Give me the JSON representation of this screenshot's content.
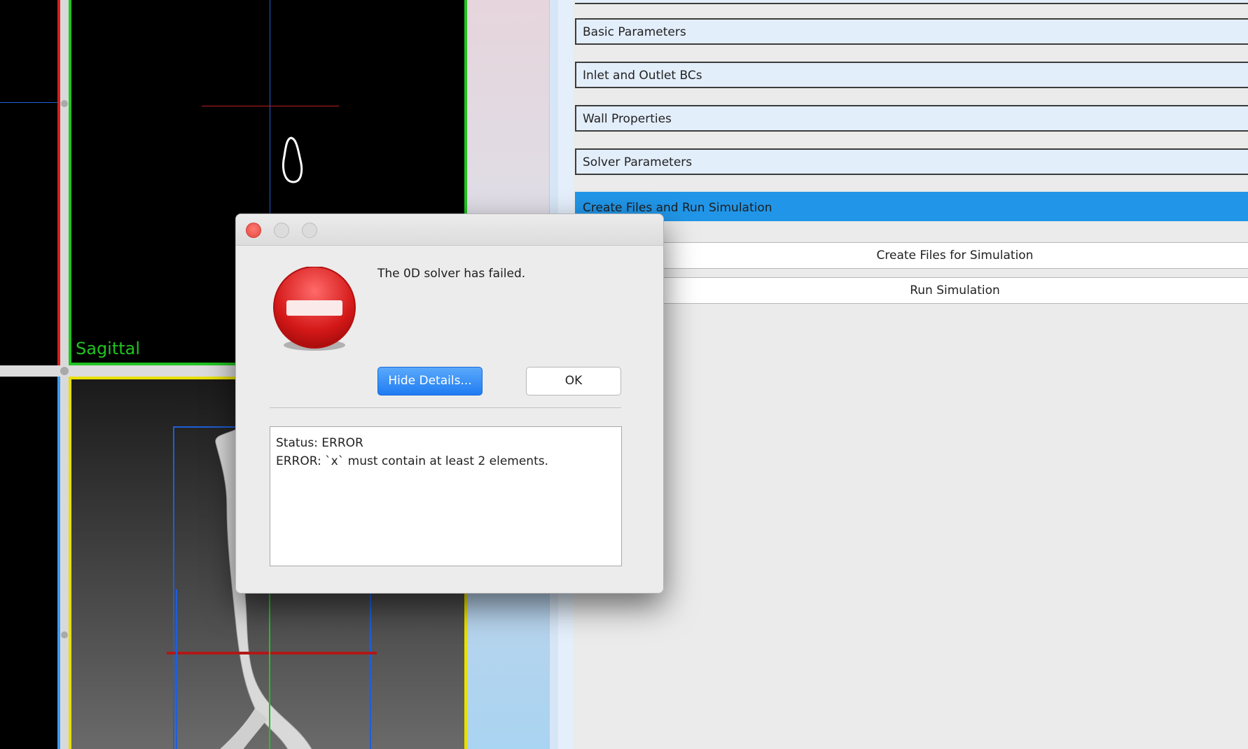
{
  "viewers": {
    "sagittal_label": "Sagittal"
  },
  "colors": {
    "sagittal_green": "#21c321",
    "axial_red": "#d42020",
    "three_d_yellow": "#e8e000",
    "accent_blue": "#2196e8"
  },
  "panel": {
    "sections": [
      {
        "label": "Basic Parameters",
        "selected": false
      },
      {
        "label": "Inlet and Outlet BCs",
        "selected": false
      },
      {
        "label": "Wall Properties",
        "selected": false
      },
      {
        "label": "Solver Parameters",
        "selected": false
      },
      {
        "label": "Create Files and Run Simulation",
        "selected": true
      }
    ],
    "create_files_button": "Create Files for Simulation",
    "run_simulation_button": "Run Simulation"
  },
  "dialog": {
    "icon": "stop-icon",
    "message": "The 0D solver has failed.",
    "hide_details_button": "Hide Details...",
    "ok_button": "OK",
    "details": {
      "line1": "Status: ERROR",
      "line2": "ERROR: `x` must contain at least 2 elements."
    }
  }
}
